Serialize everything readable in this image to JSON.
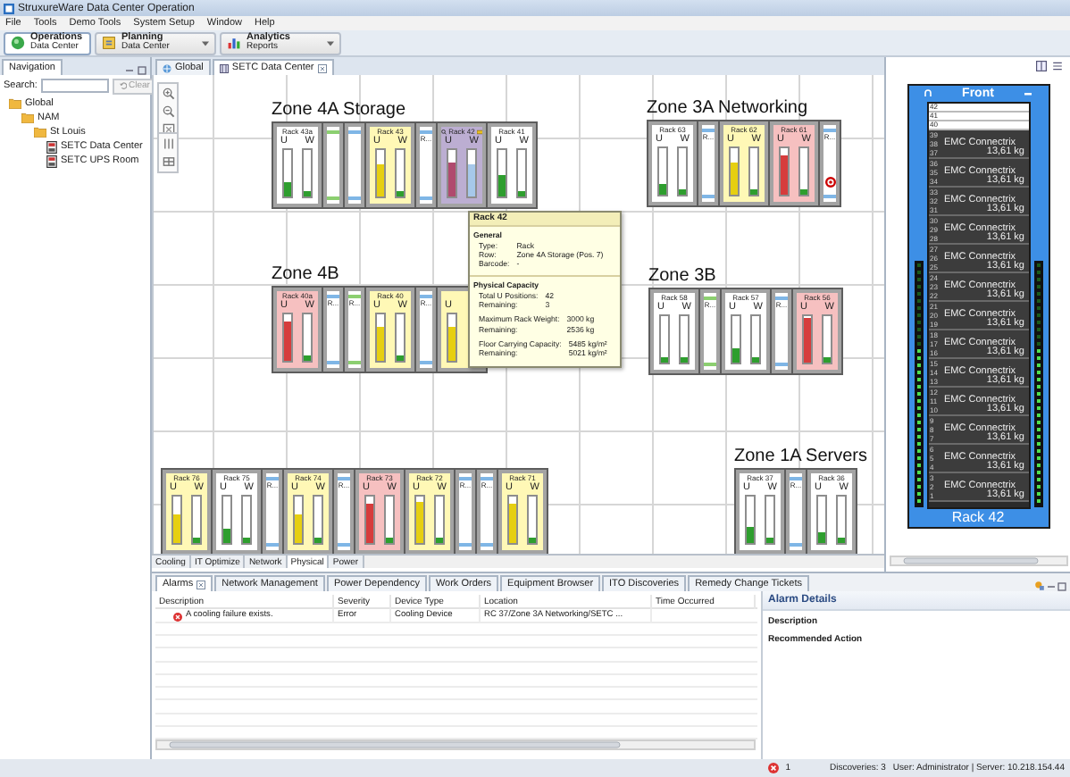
{
  "window": {
    "title": "StruxureWare Data Center Operation"
  },
  "menu": [
    "File",
    "Tools",
    "Demo Tools",
    "System Setup",
    "Window",
    "Help"
  ],
  "perspectives": [
    {
      "kind": "operations",
      "title": "Operations",
      "subtitle": "Data Center",
      "selected": true,
      "dropdown": false
    },
    {
      "kind": "planning",
      "title": "Planning",
      "subtitle": "Data Center",
      "selected": false,
      "dropdown": true
    },
    {
      "kind": "analytics",
      "title": "Analytics",
      "subtitle": "Reports",
      "selected": false,
      "dropdown": true
    }
  ],
  "navigation": {
    "title": "Navigation",
    "search_label": "Search:",
    "clear_button": {
      "label": "Clear",
      "disabled": true
    },
    "tree": [
      {
        "label": "Global",
        "kind": "folder",
        "children": [
          {
            "label": "NAM",
            "kind": "folder",
            "children": [
              {
                "label": "St Louis",
                "kind": "folder",
                "children": [
                  {
                    "label": "SETC Data Center",
                    "kind": "room"
                  },
                  {
                    "label": "SETC UPS Room",
                    "kind": "room"
                  }
                ]
              }
            ]
          }
        ]
      }
    ]
  },
  "editor_tabs": [
    {
      "label": "Global",
      "selected": false,
      "closable": false
    },
    {
      "label": "SETC Data Center",
      "selected": true,
      "closable": true
    }
  ],
  "floor_plan": {
    "zones": [
      {
        "title": "Zone 4A Storage",
        "racks": [
          {
            "kind": "rack",
            "label": "Rack 43a",
            "u_label": "U",
            "w_label": "W",
            "color": "#ffffff",
            "selected": false,
            "u_meter": {
              "level": 0.3,
              "color": "#2e9e2e"
            },
            "w_meter": {
              "level": 0.12,
              "color": "#2e9e2e"
            }
          },
          {
            "kind": "cooler",
            "color": "#8ccf70",
            "selected": false,
            "alarm": false
          },
          {
            "kind": "cooler",
            "color": "#7fb6e6",
            "selected": false,
            "alarm": false
          },
          {
            "kind": "rack",
            "label": "Rack 43",
            "u_label": "U",
            "w_label": "W",
            "color": "#fff8b6",
            "selected": false,
            "u_meter": {
              "level": 0.7,
              "color": "#e6cf10"
            },
            "w_meter": {
              "level": 0.12,
              "color": "#2e9e2e"
            }
          },
          {
            "kind": "cooler",
            "label": "R...",
            "color": "#7fb6e6",
            "selected": false,
            "alarm": false
          },
          {
            "kind": "rack",
            "label": "Rack 42",
            "u_label": "U",
            "w_label": "W",
            "color": "#bcaed2",
            "selected": true,
            "u_meter": {
              "level": 0.75,
              "color": "#b04a6e"
            },
            "w_meter": {
              "level": 0.7,
              "color": "#a6c8ea"
            }
          },
          {
            "kind": "rack",
            "label": "Rack 41",
            "u_label": "U",
            "w_label": "W",
            "color": "#ffffff",
            "selected": false,
            "u_meter": {
              "level": 0.45,
              "color": "#2e9e2e"
            },
            "w_meter": {
              "level": 0.12,
              "color": "#2e9e2e"
            }
          }
        ]
      },
      {
        "title": "Zone 4B",
        "racks": [
          {
            "kind": "rack",
            "label": "Rack 40a",
            "u_label": "U",
            "w_label": "W",
            "color": "#f6c0c0",
            "selected": false,
            "u_meter": {
              "level": 0.85,
              "color": "#d63c3c"
            },
            "w_meter": {
              "level": 0.12,
              "color": "#2e9e2e"
            }
          },
          {
            "kind": "cooler",
            "label": "R...",
            "color": "#7fb6e6",
            "selected": false,
            "alarm": false
          },
          {
            "kind": "cooler",
            "label": "R...",
            "color": "#8ccf70",
            "selected": false,
            "alarm": false
          },
          {
            "kind": "rack",
            "label": "Rack 40",
            "u_label": "U",
            "w_label": "W",
            "color": "#fff8b6",
            "selected": false,
            "u_meter": {
              "level": 0.75,
              "color": "#e6cf10"
            },
            "w_meter": {
              "level": 0.12,
              "color": "#2e9e2e"
            }
          },
          {
            "kind": "cooler",
            "label": "R...",
            "color": "#7fb6e6",
            "selected": false,
            "alarm": false
          },
          {
            "kind": "rack",
            "u_label": "U",
            "color": "#fff8b6",
            "selected": false,
            "u_meter": {
              "level": 0.75,
              "color": "#e6cf10"
            }
          }
        ]
      },
      {
        "title": "Zone 3A Networking",
        "racks": [
          {
            "kind": "rack",
            "label": "Rack 63",
            "u_label": "U",
            "w_label": "W",
            "color": "#ffffff",
            "selected": false,
            "u_meter": {
              "level": 0.25,
              "color": "#2e9e2e"
            },
            "w_meter": {
              "level": 0.1,
              "color": "#2e9e2e"
            }
          },
          {
            "kind": "cooler",
            "label": "R...",
            "color": "#7fb6e6",
            "selected": false,
            "alarm": false
          },
          {
            "kind": "rack",
            "label": "Rack 62",
            "u_label": "U",
            "w_label": "W",
            "color": "#fff8b6",
            "selected": false,
            "u_meter": {
              "level": 0.7,
              "color": "#e6cf10"
            },
            "w_meter": {
              "level": 0.1,
              "color": "#2e9e2e"
            }
          },
          {
            "kind": "rack",
            "label": "Rack 61",
            "u_label": "U",
            "w_label": "W",
            "color": "#f6c0c0",
            "selected": false,
            "u_meter": {
              "level": 0.85,
              "color": "#d63c3c"
            },
            "w_meter": {
              "level": 0.1,
              "color": "#2e9e2e"
            }
          },
          {
            "kind": "cooler",
            "label": "R...",
            "color": "#7fb6e6",
            "selected": false,
            "alarm": true
          }
        ]
      },
      {
        "title": "Zone 3B",
        "racks": [
          {
            "kind": "rack",
            "label": "Rack 58",
            "u_label": "U",
            "w_label": "W",
            "color": "#ffffff",
            "selected": false,
            "u_meter": {
              "level": 0.1,
              "color": "#2e9e2e"
            },
            "w_meter": {
              "level": 0.1,
              "color": "#2e9e2e"
            }
          },
          {
            "kind": "cooler",
            "label": "R...",
            "color": "#8ccf70",
            "selected": false,
            "alarm": false
          },
          {
            "kind": "rack",
            "label": "Rack 57",
            "u_label": "U",
            "w_label": "W",
            "color": "#ffffff",
            "selected": false,
            "u_meter": {
              "level": 0.3,
              "color": "#2e9e2e"
            },
            "w_meter": {
              "level": 0.12,
              "color": "#2e9e2e"
            }
          },
          {
            "kind": "cooler",
            "label": "R...",
            "color": "#7fb6e6",
            "selected": false,
            "alarm": false
          },
          {
            "kind": "rack",
            "label": "Rack 56",
            "u_label": "U",
            "w_label": "W",
            "color": "#f6c0c0",
            "selected": false,
            "u_meter": {
              "level": 0.95,
              "color": "#d63c3c"
            },
            "w_meter": {
              "level": 0.12,
              "color": "#2e9e2e"
            }
          }
        ]
      },
      {
        "racks": [
          {
            "kind": "rack",
            "label": "Rack 76",
            "u_label": "U",
            "w_label": "W",
            "color": "#fff8b6",
            "selected": false,
            "u_meter": {
              "level": 0.6,
              "color": "#e6cf10"
            },
            "w_meter": {
              "level": 0.12,
              "color": "#2e9e2e"
            }
          },
          {
            "kind": "rack",
            "label": "Rack 75",
            "u_label": "U",
            "w_label": "W",
            "color": "#ffffff",
            "selected": false,
            "u_meter": {
              "level": 0.3,
              "color": "#2e9e2e"
            },
            "w_meter": {
              "level": 0.12,
              "color": "#2e9e2e"
            }
          },
          {
            "kind": "cooler",
            "label": "R...",
            "color": "#7fb6e6",
            "selected": false,
            "alarm": false
          },
          {
            "kind": "rack",
            "label": "Rack 74",
            "u_label": "U",
            "w_label": "W",
            "color": "#fff8b6",
            "selected": false,
            "u_meter": {
              "level": 0.6,
              "color": "#e6cf10"
            },
            "w_meter": {
              "level": 0.12,
              "color": "#2e9e2e"
            }
          },
          {
            "kind": "cooler",
            "label": "R...",
            "color": "#7fb6e6",
            "selected": false,
            "alarm": false
          },
          {
            "kind": "rack",
            "label": "Rack 73",
            "u_label": "U",
            "w_label": "W",
            "color": "#f6c0c0",
            "selected": false,
            "u_meter": {
              "level": 0.85,
              "color": "#d63c3c"
            },
            "w_meter": {
              "level": 0.1,
              "color": "#2e9e2e"
            }
          },
          {
            "kind": "rack",
            "label": "Rack 72",
            "u_label": "U",
            "w_label": "W",
            "color": "#fff8b6",
            "selected": false,
            "u_meter": {
              "level": 0.9,
              "color": "#e6cf10"
            },
            "w_meter": {
              "level": 0.1,
              "color": "#2e9e2e"
            }
          },
          {
            "kind": "cooler",
            "label": "R...",
            "color": "#7fb6e6",
            "selected": false,
            "alarm": false
          },
          {
            "kind": "cooler",
            "label": "R...",
            "color": "#7fb6e6",
            "selected": false,
            "alarm": false
          },
          {
            "kind": "rack",
            "label": "Rack 71",
            "u_label": "U",
            "w_label": "W",
            "color": "#fff8b6",
            "selected": false,
            "u_meter": {
              "level": 0.85,
              "color": "#e6cf10"
            },
            "w_meter": {
              "level": 0.1,
              "color": "#2e9e2e"
            }
          }
        ]
      },
      {
        "title": "Zone 1A Servers",
        "racks": [
          {
            "kind": "rack",
            "label": "Rack 37",
            "u_label": "U",
            "w_label": "W",
            "color": "#ffffff",
            "selected": false,
            "u_meter": {
              "level": 0.35,
              "color": "#2e9e2e"
            },
            "w_meter": {
              "level": 0.1,
              "color": "#2e9e2e"
            }
          },
          {
            "kind": "cooler",
            "label": "R...",
            "color": "#7fb6e6",
            "selected": false,
            "alarm": false
          },
          {
            "kind": "rack",
            "label": "Rack 36",
            "u_label": "U",
            "w_label": "W",
            "color": "#ffffff",
            "selected": false,
            "u_meter": {
              "level": 0.25,
              "color": "#2e9e2e"
            },
            "w_meter": {
              "level": 0.1,
              "color": "#2e9e2e"
            }
          }
        ]
      }
    ],
    "tooltip": {
      "title": "Rack 42",
      "sections": [
        {
          "heading": "General",
          "groups": [
            [
              {
                "label": "Type:",
                "value": "Rack"
              },
              {
                "label": "Row:",
                "value": "Zone 4A Storage (Pos. 7)"
              },
              {
                "label": "Barcode:",
                "value": "-"
              }
            ]
          ]
        },
        {
          "heading": "Physical Capacity",
          "groups": [
            [
              {
                "label": "Total U Positions:",
                "value": "42"
              },
              {
                "label": "Remaining:",
                "value": "3"
              }
            ],
            [
              {
                "label": "Maximum Rack Weight:",
                "value": "3000 kg"
              },
              {
                "label": "Remaining:",
                "value": "2536 kg"
              }
            ],
            [
              {
                "label": "Floor Carrying Capacity:",
                "value": "5485 kg/m²"
              },
              {
                "label": "Remaining:",
                "value": "5021 kg/m²"
              }
            ]
          ]
        }
      ]
    }
  },
  "view_tabs": [
    {
      "label": "Cooling",
      "selected": false
    },
    {
      "label": "IT Optimize",
      "selected": false
    },
    {
      "label": "Network",
      "selected": false
    },
    {
      "label": "Physical",
      "selected": true
    },
    {
      "label": "Power",
      "selected": false
    }
  ],
  "rack_view": {
    "title": "Front",
    "empty_slots": [
      "42",
      "41",
      "40"
    ],
    "footer": "Rack 42",
    "devices": [
      {
        "units": [
          "39",
          "38",
          "37"
        ],
        "name": "EMC Connectrix",
        "weight": "13,61 kg"
      },
      {
        "units": [
          "36",
          "35",
          "34"
        ],
        "name": "EMC Connectrix",
        "weight": "13,61 kg"
      },
      {
        "units": [
          "33",
          "32",
          "31"
        ],
        "name": "EMC Connectrix",
        "weight": "13,61 kg"
      },
      {
        "units": [
          "30",
          "29",
          "28"
        ],
        "name": "EMC Connectrix",
        "weight": "13,61 kg"
      },
      {
        "units": [
          "27",
          "26",
          "25"
        ],
        "name": "EMC Connectrix",
        "weight": "13,61 kg"
      },
      {
        "units": [
          "24",
          "23",
          "22"
        ],
        "name": "EMC Connectrix",
        "weight": "13,61 kg"
      },
      {
        "units": [
          "21",
          "20",
          "19"
        ],
        "name": "EMC Connectrix",
        "weight": "13,61 kg"
      },
      {
        "units": [
          "18",
          "17",
          "16"
        ],
        "name": "EMC Connectrix",
        "weight": "13,61 kg"
      },
      {
        "units": [
          "15",
          "14",
          "13"
        ],
        "name": "EMC Connectrix",
        "weight": "13,61 kg"
      },
      {
        "units": [
          "12",
          "11",
          "10"
        ],
        "name": "EMC Connectrix",
        "weight": "13,61 kg"
      },
      {
        "units": [
          "9",
          "8",
          "7"
        ],
        "name": "EMC Connectrix",
        "weight": "13,61 kg"
      },
      {
        "units": [
          "6",
          "5",
          "4"
        ],
        "name": "EMC Connectrix",
        "weight": "13,61 kg"
      },
      {
        "units": [
          "3",
          "2",
          "1"
        ],
        "name": "EMC Connectrix",
        "weight": "13,61 kg"
      }
    ]
  },
  "bottom_tabs": [
    {
      "label": "Alarms",
      "selected": true,
      "closable": true
    },
    {
      "label": "Network Management",
      "selected": false,
      "closable": false
    },
    {
      "label": "Power Dependency",
      "selected": false,
      "closable": false
    },
    {
      "label": "Work Orders",
      "selected": false,
      "closable": false
    },
    {
      "label": "Equipment Browser",
      "selected": false,
      "closable": false
    },
    {
      "label": "ITO Discoveries",
      "selected": false,
      "closable": false
    },
    {
      "label": "Remedy Change Tickets",
      "selected": false,
      "closable": false
    }
  ],
  "alarms": {
    "columns": [
      "Description",
      "Severity",
      "Device Type",
      "Location",
      "Time Occurred"
    ],
    "rows": [
      {
        "has_icon": true,
        "cells": [
          "A cooling failure exists.",
          "Error",
          "Cooling Device",
          "RC 37/Zone 3A Networking/SETC ..."
        ]
      }
    ]
  },
  "alarm_details": {
    "title": "Alarm Details",
    "fields": [
      "Description",
      "Recommended Action"
    ]
  },
  "status_bar": {
    "error_count": "1",
    "discoveries": "Discoveries: 3",
    "user_server": "User: Administrator | Server: 10.218.154.44"
  }
}
